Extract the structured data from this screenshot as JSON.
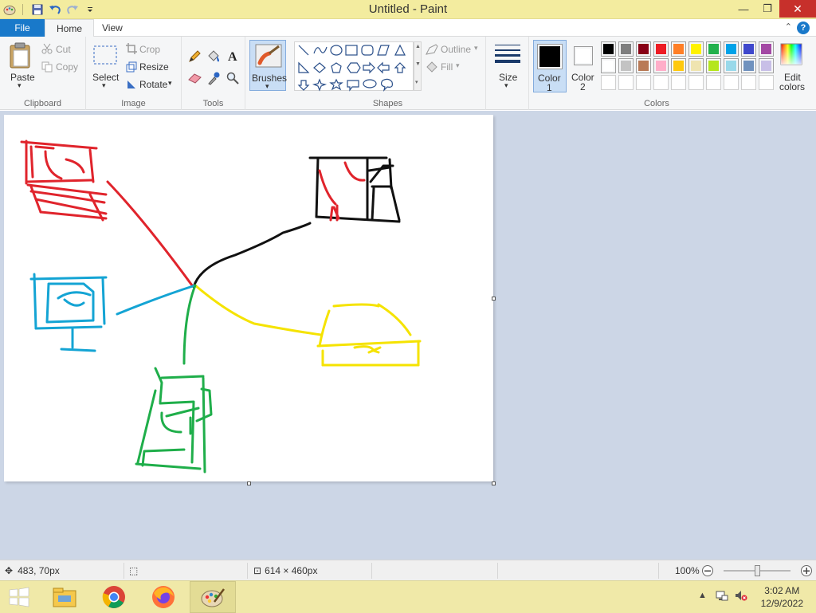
{
  "window": {
    "title": "Untitled - Paint"
  },
  "quick_access": {
    "icons": [
      "paint-app-icon",
      "save-icon",
      "undo-icon",
      "redo-icon",
      "customize-qat-icon"
    ]
  },
  "tabs": {
    "file": "File",
    "home": "Home",
    "view": "View"
  },
  "ribbon": {
    "clipboard": {
      "label": "Clipboard",
      "paste": "Paste",
      "cut": "Cut",
      "copy": "Copy"
    },
    "image": {
      "label": "Image",
      "select": "Select",
      "crop": "Crop",
      "resize": "Resize",
      "rotate": "Rotate"
    },
    "tools": {
      "label": "Tools"
    },
    "brushes": {
      "label": "Brushes"
    },
    "shapes": {
      "label": "Shapes",
      "outline": "Outline",
      "fill": "Fill"
    },
    "size": {
      "label": "Size"
    },
    "color1": {
      "label1": "Color",
      "label2": "1",
      "color": "#000000"
    },
    "color2": {
      "label1": "Color",
      "label2": "2",
      "color": "#ffffff"
    },
    "colors": {
      "label": "Colors",
      "edit1": "Edit",
      "edit2": "colors",
      "row1": [
        "#000000",
        "#7f7f7f",
        "#880015",
        "#ed1c24",
        "#ff7f27",
        "#fff200",
        "#22b14c",
        "#00a2e8",
        "#3f48cc",
        "#a349a4"
      ],
      "row2": [
        "#ffffff",
        "#c3c3c3",
        "#b97a57",
        "#ffaec9",
        "#ffc90e",
        "#efe4b0",
        "#b5e61d",
        "#99d9ea",
        "#7092be",
        "#c8bfe7"
      ],
      "row3": [
        "#ffffff",
        "#ffffff",
        "#ffffff",
        "#ffffff",
        "#ffffff",
        "#ffffff",
        "#ffffff",
        "#ffffff",
        "#ffffff",
        "#ffffff"
      ]
    }
  },
  "status": {
    "cursor_pos": "483, 70px",
    "canvas_size": "614 × 460px",
    "zoom": "100%",
    "zoom_level": 0.5
  },
  "taskbar": {
    "apps": [
      "start-button",
      "file-explorer",
      "chrome",
      "firefox",
      "paint"
    ],
    "time": "3:02 AM",
    "date": "12/9/2022"
  }
}
